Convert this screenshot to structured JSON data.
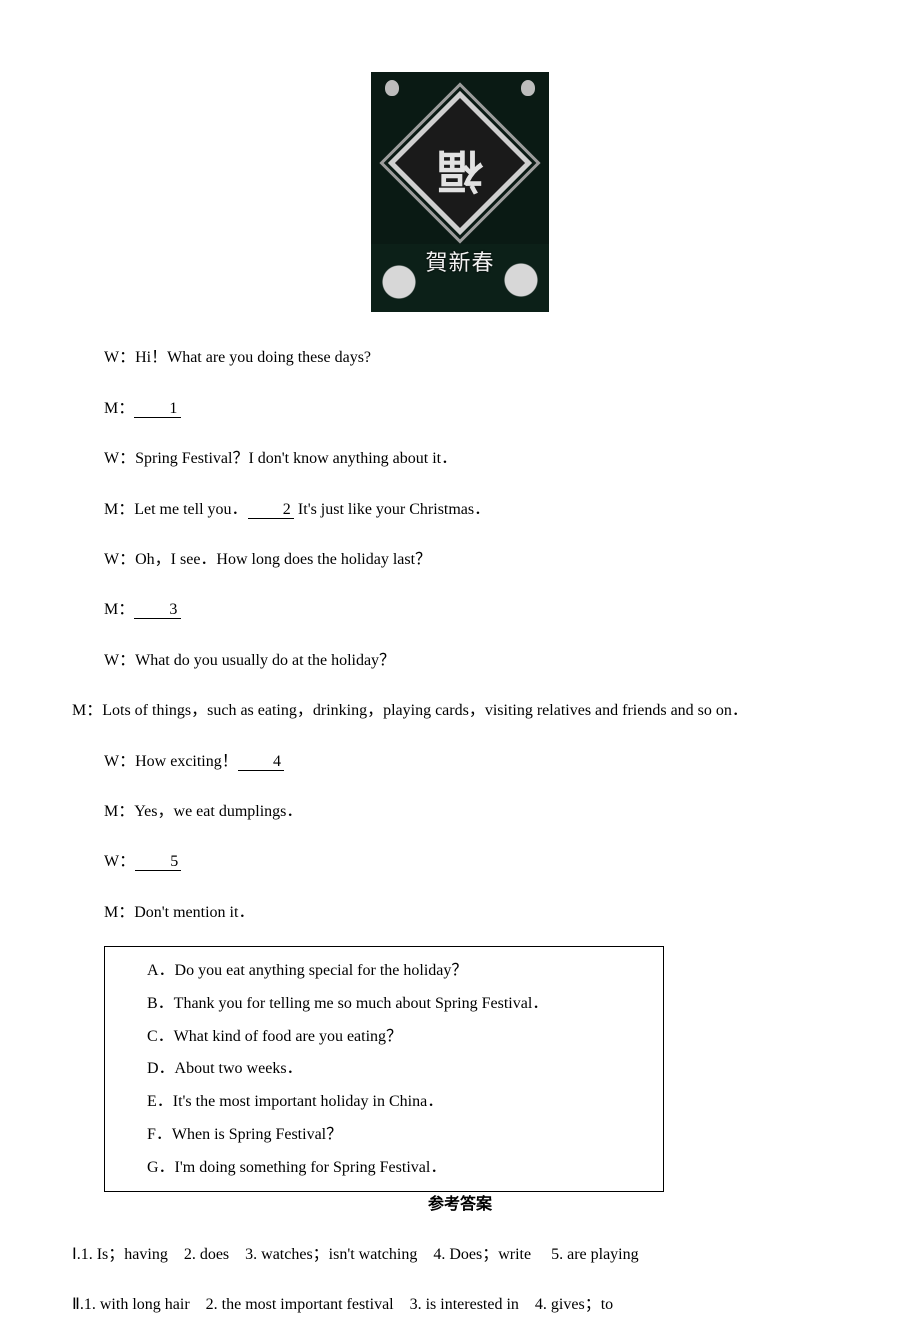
{
  "image": {
    "name": "spring-festival-greeting-image",
    "fu_char": "福",
    "banner": "賀新春"
  },
  "dialogue": {
    "l01": "W：Hi！What are you doing these days?",
    "l02_pre": "M：",
    "l02_blank": "1",
    "l03": "W：Spring Festival？I don't know anything about it．",
    "l04_pre": "M：Let me tell you．",
    "l04_blank": "2",
    "l04_post": " It's just like your Christmas．",
    "l05": "W：Oh，I see．How long does the holiday last？",
    "l06_pre": "M：",
    "l06_blank": "3",
    "l07": "W：What do you usually do at the holiday？",
    "l08": "M：Lots of things，such as eating，drinking，playing cards，visiting relatives and friends and so on．",
    "l09_pre": "W：How exciting！",
    "l09_blank": "4",
    "l10": "M：Yes，we eat dumplings．",
    "l11_pre": "W：",
    "l11_blank": "5",
    "l12": "M：Don't mention it．"
  },
  "options": {
    "A": "A．Do you eat anything special for the holiday？",
    "B": "B．Thank you for telling me so much about Spring Festival．",
    "C": "C．What kind of food are you eating？",
    "D": "D．About two weeks．",
    "E": "E．It's the most important holiday in China．",
    "F": "F．When is Spring Festival？",
    "G": "G．I'm doing something for Spring Festival．"
  },
  "answers": {
    "title": "参考答案",
    "sec1": "Ⅰ.1. Is；having　2. does　3. watches；isn't watching　4. Does；write　 5. are playing",
    "sec2": "Ⅱ.1. with long hair　2. the most important festival　3. is interested in　4. gives；to"
  }
}
